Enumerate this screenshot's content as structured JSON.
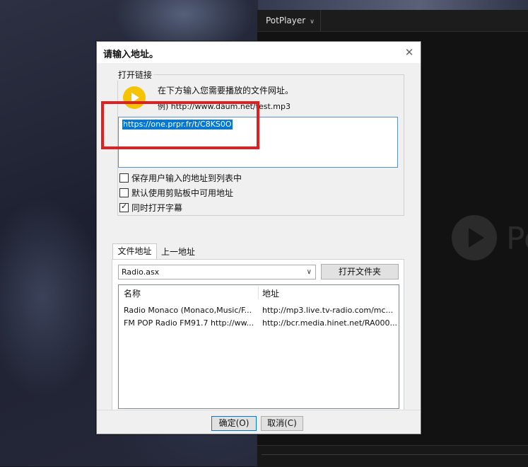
{
  "potplayer": {
    "title": "PotPlayer",
    "logo_text": "Po"
  },
  "dialog": {
    "title": "请输入地址。",
    "close": "✕",
    "group_label": "打开链接",
    "hint_line1": "在下方输入您需要播放的文件网址。",
    "hint_line2": "例) http://www.daum.net/test.mp3",
    "url_value": "https://one.prpr.fr/t/C8KS0O",
    "checkboxes": [
      {
        "label": "保存用户输入的地址到列表中",
        "checked": false
      },
      {
        "label": "默认使用剪贴板中可用地址",
        "checked": false
      },
      {
        "label": "同时打开字幕",
        "checked": true
      }
    ],
    "tabs": [
      "文件地址",
      "上一地址"
    ],
    "select_value": "Radio.asx",
    "open_folder_button": "打开文件夹",
    "list": {
      "columns": [
        "名称",
        "地址"
      ],
      "rows": [
        {
          "name": "Radio Monaco (Monaco,Music/F...",
          "url": "http://mp3.live.tv-radio.com/mc..."
        },
        {
          "name": "FM POP Radio FM91.7 http://ww...",
          "url": "http://bcr.media.hinet.net/RA000..."
        }
      ]
    },
    "ok_button": "确定(O)",
    "cancel_button": "取消(C)"
  },
  "annotation": {
    "highlight_color": "#e02020"
  }
}
